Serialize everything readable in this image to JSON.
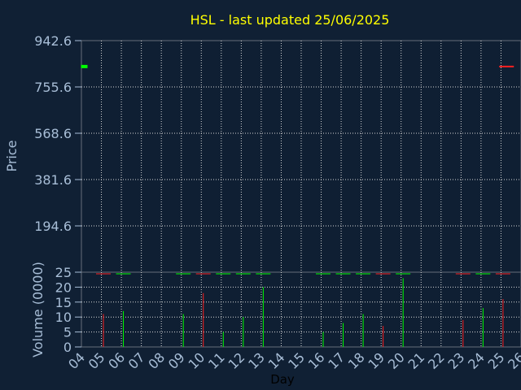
{
  "chart_data": [
    {
      "type": "ohlc",
      "title": "HSL - last updated 25/06/2025",
      "ylabel": "Price",
      "ylim": [
        7.6,
        942.6
      ],
      "y_ticks": [
        "942.6",
        "755.6",
        "568.6",
        "381.6",
        "194.6"
      ],
      "grid": true,
      "points": [
        {
          "day": 4.02,
          "open": 838,
          "close": 838,
          "direction": "up"
        },
        {
          "day": 24.95,
          "open": 838,
          "close": 838,
          "direction": "down"
        }
      ]
    },
    {
      "type": "bar",
      "ylabel": "Volume (0000)",
      "xlabel": "Day",
      "ylim": [
        0,
        25
      ],
      "y_ticks": [
        "25",
        "20",
        "15",
        "10",
        "5",
        "0"
      ],
      "x_ticks": [
        "04",
        "05",
        "06",
        "07",
        "08",
        "09",
        "10",
        "11",
        "12",
        "13",
        "14",
        "15",
        "16",
        "17",
        "18",
        "19",
        "20",
        "21",
        "22",
        "23",
        "24",
        "25",
        "26"
      ],
      "grid": true,
      "bars": [
        {
          "day": 5.1,
          "value": 11,
          "direction": "down"
        },
        {
          "day": 6.1,
          "value": 12,
          "direction": "up"
        },
        {
          "day": 9.1,
          "value": 11,
          "direction": "up"
        },
        {
          "day": 10.1,
          "value": 18,
          "direction": "down"
        },
        {
          "day": 11.1,
          "value": 5,
          "direction": "up"
        },
        {
          "day": 12.1,
          "value": 10,
          "direction": "up"
        },
        {
          "day": 13.1,
          "value": 20,
          "direction": "up"
        },
        {
          "day": 16.1,
          "value": 5,
          "direction": "up"
        },
        {
          "day": 17.1,
          "value": 8,
          "direction": "up"
        },
        {
          "day": 18.1,
          "value": 11,
          "direction": "up"
        },
        {
          "day": 19.1,
          "value": 7,
          "direction": "down"
        },
        {
          "day": 20.1,
          "value": 23,
          "direction": "up"
        },
        {
          "day": 23.1,
          "value": 9,
          "direction": "down"
        },
        {
          "day": 24.1,
          "value": 13,
          "direction": "up"
        },
        {
          "day": 25.1,
          "value": 16,
          "direction": "down"
        }
      ]
    }
  ],
  "colors": {
    "background": "#102034",
    "plot_background": "#0f1f33",
    "grid": "#d8d8d8",
    "text": "#a8bed7",
    "title": "#ffff00",
    "up": "#00ff00",
    "down": "#ff2020",
    "xlabel": "#000000"
  }
}
